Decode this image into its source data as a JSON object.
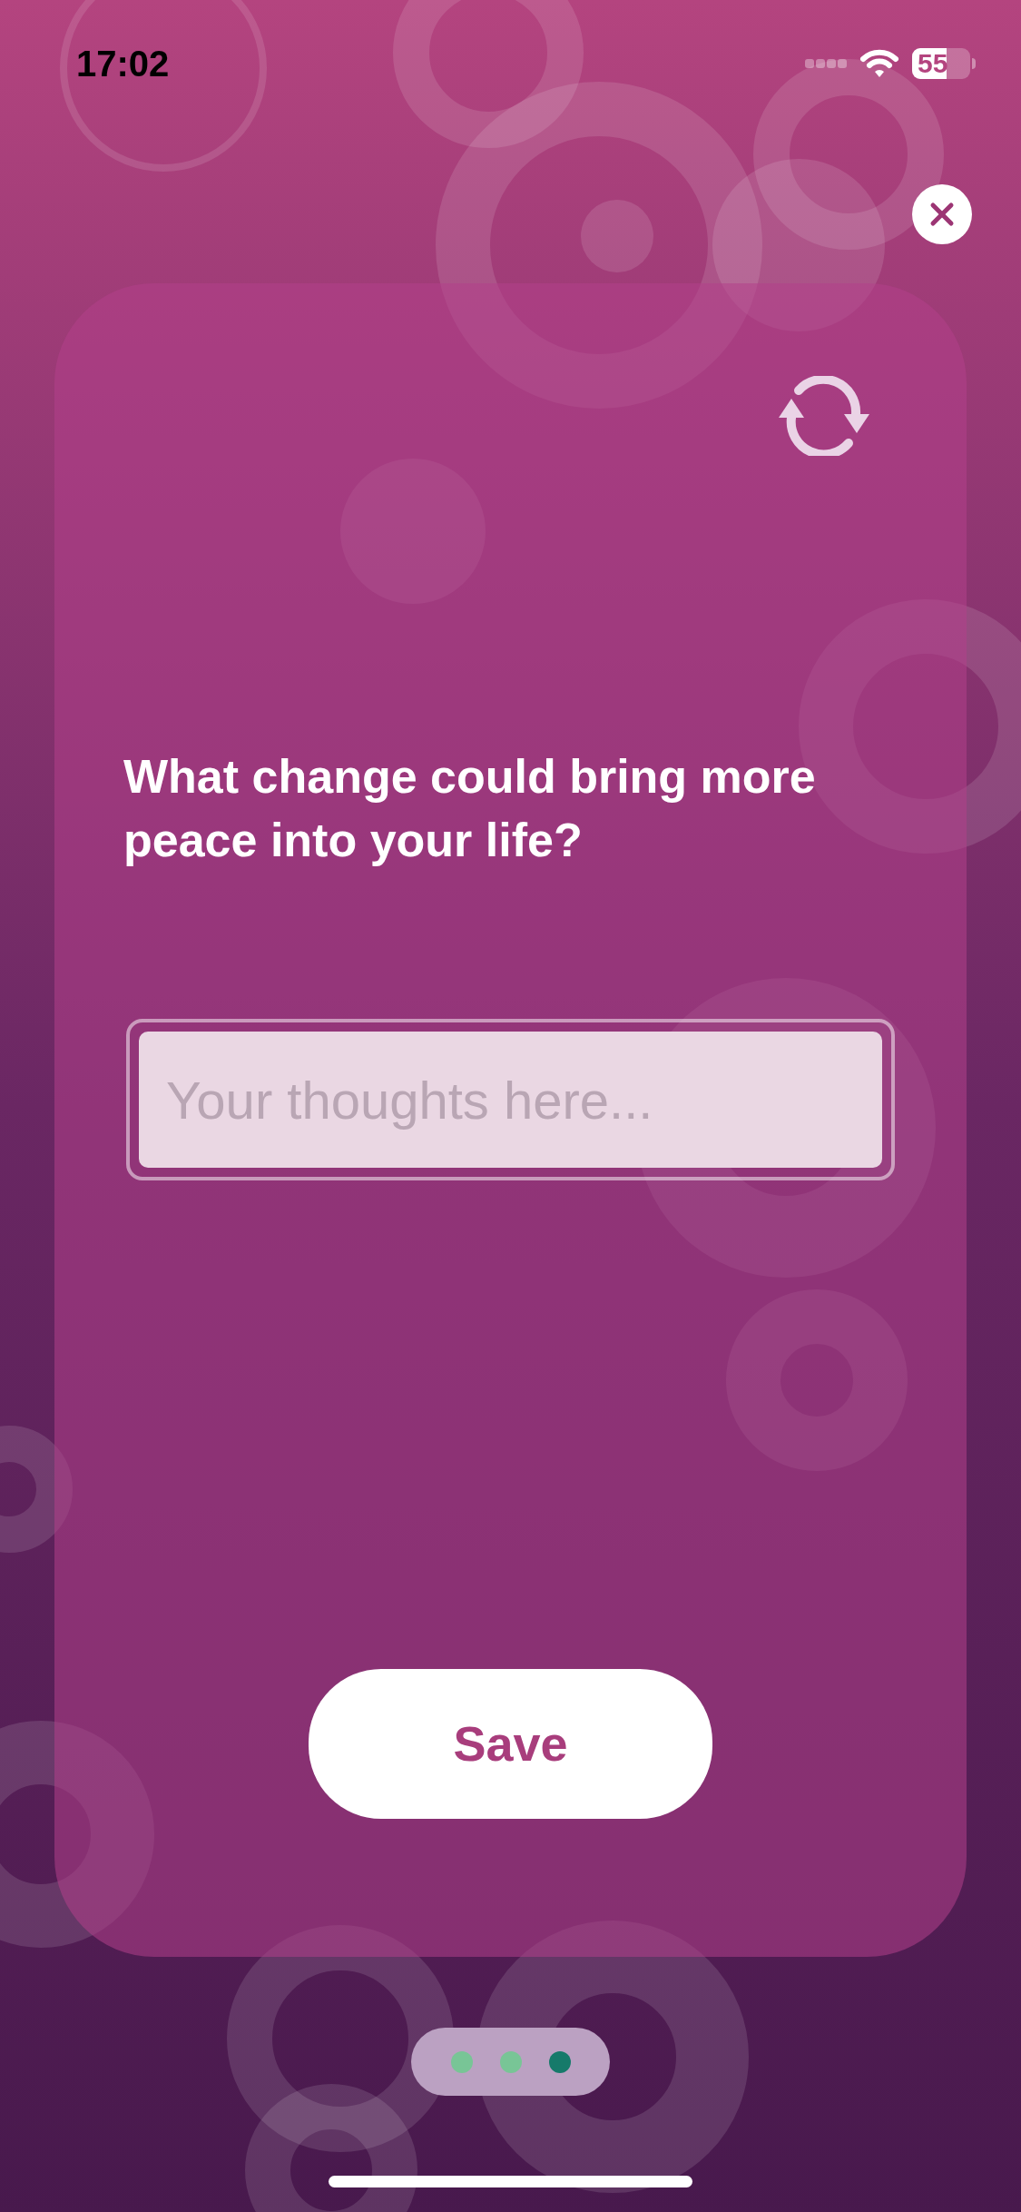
{
  "status_bar": {
    "time": "17:02",
    "battery": "55"
  },
  "question": "What change could bring more peace into your life?",
  "answer_field": {
    "placeholder": "Your thoughts here..."
  },
  "save_button": {
    "label": "Save"
  },
  "pages": [
    {
      "selected": false
    },
    {
      "selected": false
    },
    {
      "selected": true
    }
  ]
}
